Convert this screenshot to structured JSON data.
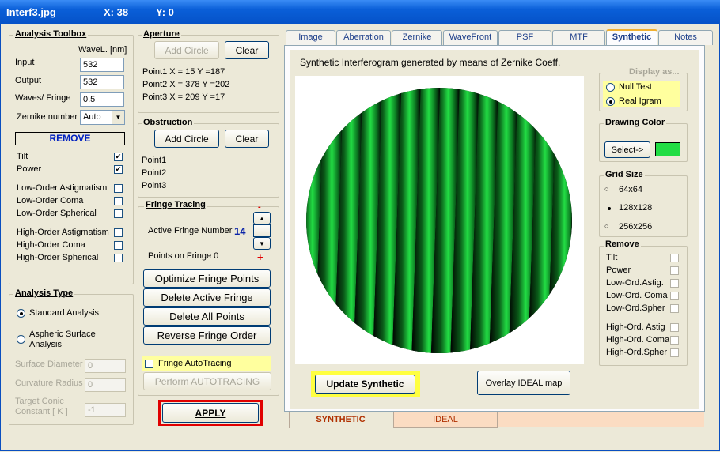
{
  "window": {
    "title": "Interf3.jpg",
    "x_label": "X: 38",
    "y_label": "Y: 0"
  },
  "toolbox": {
    "title": "Analysis Toolbox",
    "wavel_header": "WaveL. [nm]",
    "input_label": "Input",
    "input_value": "532",
    "output_label": "Output",
    "output_value": "532",
    "waves_label": "Waves/ Fringe",
    "waves_value": "0.5",
    "zernike_label": "Zernike number",
    "zernike_value": "Auto",
    "remove_label": "REMOVE",
    "terms": [
      {
        "label": "Tilt",
        "checked": true
      },
      {
        "label": "Power",
        "checked": true
      },
      {
        "label": "Low-Order  Astigmatism",
        "checked": false
      },
      {
        "label": "Low-Order  Coma",
        "checked": false
      },
      {
        "label": "Low-Order  Spherical",
        "checked": false
      },
      {
        "label": "High-Order  Astigmatism",
        "checked": false
      },
      {
        "label": "High-Order  Coma",
        "checked": false
      },
      {
        "label": "High-Order  Spherical",
        "checked": false
      }
    ]
  },
  "analysis_type": {
    "title": "Analysis Type",
    "standard": "Standard  Analysis",
    "aspheric_line1": "Aspheric  Surface",
    "aspheric_line2": "Analysis",
    "surface_diameter_label": "Surface Diameter",
    "surface_diameter_value": "0",
    "curvature_radius_label": "Curvature Radius",
    "curvature_radius_value": "0",
    "conic_label_line1": "Target Conic",
    "conic_label_line2": "Constant [ K ]",
    "conic_value": "-1"
  },
  "aperture": {
    "title": "Aperture",
    "add_circle": "Add Circle",
    "clear": "Clear",
    "points": [
      "Point1 X =   15  Y =187",
      "Point2 X =  378  Y =202",
      "Point3 X =  209  Y =17"
    ]
  },
  "obstruction": {
    "title": "Obstruction",
    "add_circle": "Add Circle",
    "clear": "Clear",
    "points": [
      "Point1",
      "Point2",
      "Point3"
    ]
  },
  "fringe_tracing": {
    "title": "Fringe Tracing",
    "active_label": "Active Fringe Number",
    "active_value": "14",
    "points_label": "Points on  Fringe 0",
    "minus": "-",
    "plus": "+",
    "optimize": "Optimize Fringe Points",
    "delete_active": "Delete Active Fringe",
    "delete_all": "Delete  All  Points",
    "reverse": "Reverse  Fringe Order",
    "autotracing": "Fringe AutoTracing",
    "perform": "Perform  AUTOTRACING"
  },
  "apply_label": "APPLY",
  "tabs": [
    {
      "label": "Image",
      "active": false
    },
    {
      "label": "Aberration",
      "active": false
    },
    {
      "label": "Zernike",
      "active": false
    },
    {
      "label": "WaveFront",
      "active": false
    },
    {
      "label": "PSF",
      "active": false
    },
    {
      "label": "MTF",
      "active": false
    },
    {
      "label": "Synthetic",
      "active": true
    },
    {
      "label": "Notes",
      "active": false
    }
  ],
  "synthetic": {
    "caption": "Synthetic Interferogram generated by means of Zernike Coeff.",
    "display_as": {
      "title": "Display as...",
      "null_test": "Null Test",
      "real_igram": "Real Igram",
      "selected": "real_igram"
    },
    "drawing_color": {
      "title": "Drawing Color",
      "select": "Select->",
      "color": "#22dd44"
    },
    "grid_size": {
      "title": "Grid Size",
      "options": [
        "64x64",
        "128x128",
        "256x256"
      ],
      "selected": 1
    },
    "remove": {
      "title": "Remove",
      "items": [
        "Tilt",
        "Power",
        "Low-Ord.Astig.",
        "Low-Ord. Coma",
        "Low-Ord.Spher",
        "High-Ord. Astig",
        "High-Ord. Coma",
        "High-Ord.Spher"
      ]
    },
    "update_button": "Update Synthetic",
    "overlay_button": "Overlay IDEAL map",
    "fringe_color": "#22dd44"
  },
  "bottom_tabs": {
    "synthetic": "SYNTHETIC",
    "ideal": "IDEAL"
  }
}
